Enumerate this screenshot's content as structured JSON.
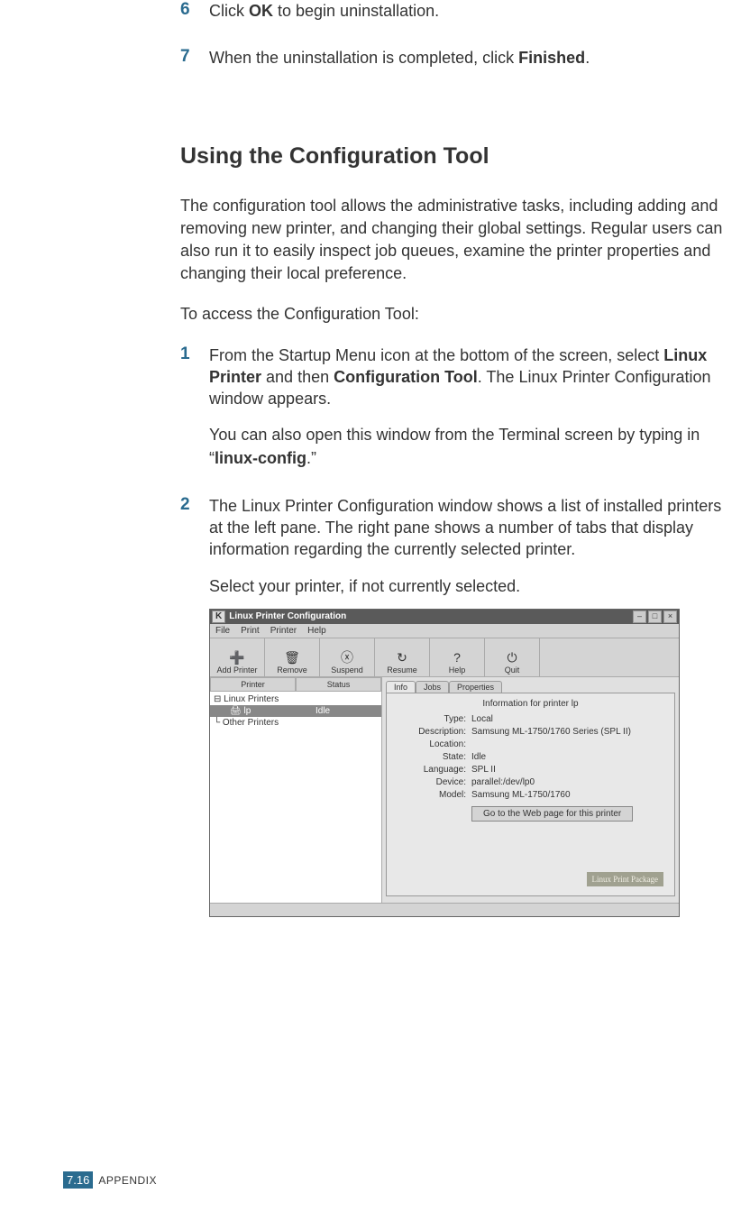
{
  "steps_top": [
    {
      "num": "6",
      "html_parts": [
        "Click ",
        {
          "b": "OK"
        },
        " to begin uninstallation."
      ]
    },
    {
      "num": "7",
      "html_parts": [
        "When the uninstallation is completed, click ",
        {
          "b": "Finished"
        },
        "."
      ]
    }
  ],
  "section_heading": "Using the Configuration Tool",
  "intro_para": "The configuration tool allows the administrative tasks, including adding and removing new printer, and changing their global settings. Regular users can also run it to easily inspect job queues, examine the printer properties and changing their local preference.",
  "access_para": "To access the Configuration Tool:",
  "steps_main": [
    {
      "num": "1",
      "body": [
        [
          "From the Startup Menu icon at the bottom of the screen, select ",
          {
            "b": "Linux Printer"
          },
          " and then ",
          {
            "b": "Configuration Tool"
          },
          ". The Linux Printer Configuration window appears."
        ],
        [
          "You can also open this window from the Terminal screen by typing in “",
          {
            "b": "linux-config"
          },
          ".”"
        ]
      ]
    },
    {
      "num": "2",
      "body": [
        [
          "The Linux Printer Configuration window shows a list of installed printers at the left pane. The right pane shows a number of tabs that display information regarding the currently selected printer."
        ],
        [
          "Select your printer, if not currently selected."
        ]
      ]
    }
  ],
  "lpc": {
    "title": "Linux Printer Configuration",
    "menus": [
      "File",
      "Print",
      "Printer",
      "Help"
    ],
    "toolbar": [
      {
        "icon": "➕",
        "label": "Add Printer"
      },
      {
        "icon": "🗑",
        "label": "Remove"
      },
      {
        "icon": "ⓧ",
        "label": "Suspend"
      },
      {
        "icon": "↻",
        "label": "Resume"
      },
      {
        "icon": "?",
        "label": "Help"
      },
      {
        "icon": "⏻",
        "label": "Quit"
      }
    ],
    "left_headers": [
      "Printer",
      "Status"
    ],
    "tree": [
      {
        "label": "Linux Printers",
        "indent": 0
      },
      {
        "label": "lp",
        "status": "Idle",
        "indent": 1,
        "selected": true
      },
      {
        "label": "Other Printers",
        "indent": 0
      }
    ],
    "tabs": [
      "Info",
      "Jobs",
      "Properties"
    ],
    "active_tab": "Info",
    "info_title": "Information for printer lp",
    "fields": [
      {
        "label": "Type:",
        "value": "Local"
      },
      {
        "label": "Description:",
        "value": "Samsung ML-1750/1760 Series (SPL II)"
      },
      {
        "label": "Location:",
        "value": ""
      },
      {
        "label": "State:",
        "value": "Idle"
      },
      {
        "label": "Language:",
        "value": "SPL II"
      },
      {
        "label": "Device:",
        "value": "parallel:/dev/lp0"
      },
      {
        "label": "Model:",
        "value": "Samsung ML-1750/1760"
      }
    ],
    "web_button": "Go to the Web page for this printer",
    "logo": "Linux Print Package"
  },
  "footer": {
    "page_prefix": "7.",
    "page_num": "16",
    "label": "APPENDIX"
  }
}
